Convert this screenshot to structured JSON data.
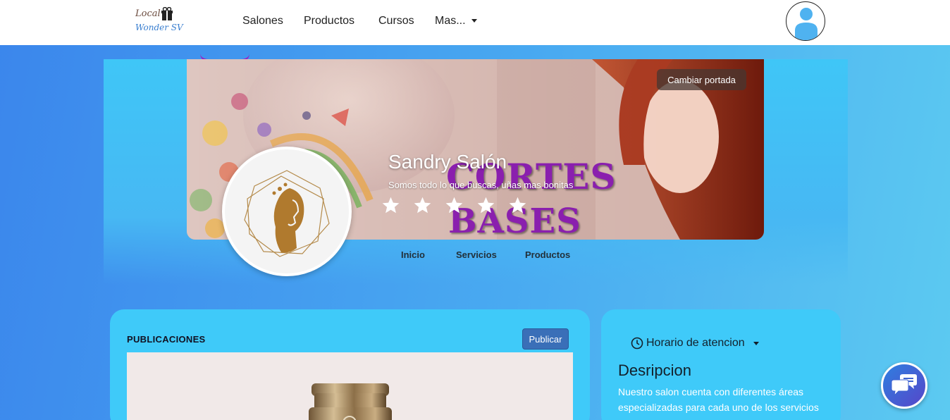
{
  "brand": {
    "line1": "Local",
    "line2": "Wonder SV"
  },
  "nav": {
    "salones": "Salones",
    "productos": "Productos",
    "cursos": "Cursos",
    "mas": "Mas..."
  },
  "cover": {
    "change_cover": "Cambiar portada",
    "salon_name": "Sandry Salón",
    "tagline": "Somos todo lo que buscas, uñas mas bonitas",
    "promo_line1": "CORTES",
    "promo_line2": "BASES",
    "rating_stars": 5
  },
  "tabs": {
    "inicio": "Inicio",
    "servicios": "Servicios",
    "productos": "Productos"
  },
  "publications": {
    "title": "PUBLICACIONES",
    "publish_button": "Publicar"
  },
  "info": {
    "hours_label": "Horario de atencion",
    "description_title": "Desripcion",
    "description_text": "Nuestro salon cuenta con diferentes áreas especializadas para cada uno de los servicios"
  },
  "colors": {
    "accent": "#3fcaf9",
    "promo": "#8a1fae",
    "button": "#3a6fb8"
  }
}
